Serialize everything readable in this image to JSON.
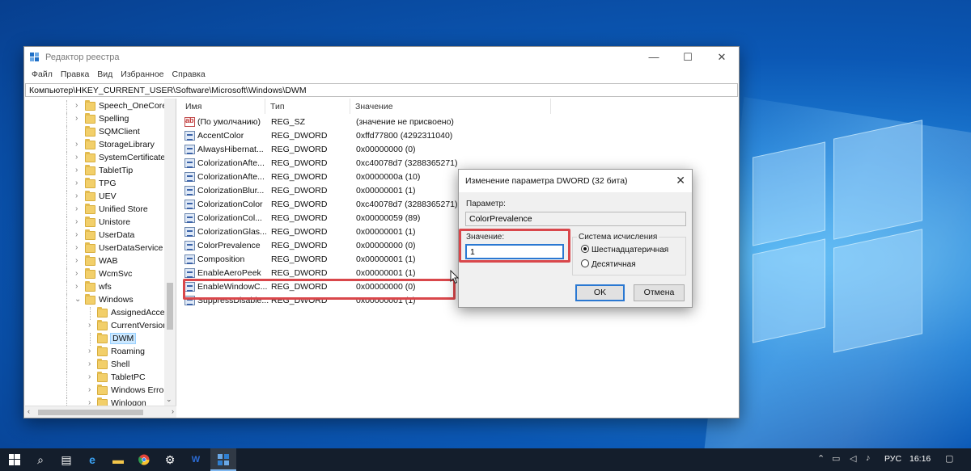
{
  "window": {
    "title": "Редактор реестра",
    "controls": {
      "minimize": "—",
      "maximize": "☐",
      "close": "✕"
    },
    "menu": [
      "Файл",
      "Правка",
      "Вид",
      "Избранное",
      "Справка"
    ],
    "address": "Компьютер\\HKEY_CURRENT_USER\\Software\\Microsoft\\Windows\\DWM"
  },
  "tree": {
    "items": [
      {
        "label": "Speech_OneCore",
        "expandable": true
      },
      {
        "label": "Spelling",
        "expandable": true
      },
      {
        "label": "SQMClient",
        "expandable": false
      },
      {
        "label": "StorageLibrary",
        "expandable": true
      },
      {
        "label": "SystemCertificate",
        "expandable": true
      },
      {
        "label": "TabletTip",
        "expandable": true
      },
      {
        "label": "TPG",
        "expandable": true
      },
      {
        "label": "UEV",
        "expandable": true
      },
      {
        "label": "Unified Store",
        "expandable": true
      },
      {
        "label": "Unistore",
        "expandable": true
      },
      {
        "label": "UserData",
        "expandable": true
      },
      {
        "label": "UserDataService",
        "expandable": true
      },
      {
        "label": "WAB",
        "expandable": true
      },
      {
        "label": "WcmSvc",
        "expandable": true
      },
      {
        "label": "wfs",
        "expandable": true
      },
      {
        "label": "Windows",
        "expandable": true,
        "expanded": true
      },
      {
        "label": "AssignedAcce",
        "expandable": false,
        "child": true
      },
      {
        "label": "CurrentVersion",
        "expandable": true,
        "child": true
      },
      {
        "label": "DWM",
        "expandable": false,
        "child": true,
        "selected": true
      },
      {
        "label": "Roaming",
        "expandable": true,
        "child": true
      },
      {
        "label": "Shell",
        "expandable": true,
        "child": true
      },
      {
        "label": "TabletPC",
        "expandable": true,
        "child": true
      },
      {
        "label": "Windows Error",
        "expandable": true,
        "child": true
      },
      {
        "label": "Winlogon",
        "expandable": true,
        "child": true
      }
    ]
  },
  "list": {
    "columns": [
      "Имя",
      "Тип",
      "Значение"
    ],
    "rows": [
      {
        "name": "(По умолчанию)",
        "type": "REG_SZ",
        "value": "(значение не присвоено)",
        "icon": "string-value-icon"
      },
      {
        "name": "AccentColor",
        "type": "REG_DWORD",
        "value": "0xffd77800 (4292311040)",
        "icon": "dword-value-icon"
      },
      {
        "name": "AlwaysHibernat...",
        "type": "REG_DWORD",
        "value": "0x00000000 (0)",
        "icon": "dword-value-icon"
      },
      {
        "name": "ColorizationAfte...",
        "type": "REG_DWORD",
        "value": "0xc40078d7 (3288365271)",
        "icon": "dword-value-icon"
      },
      {
        "name": "ColorizationAfte...",
        "type": "REG_DWORD",
        "value": "0x0000000a (10)",
        "icon": "dword-value-icon"
      },
      {
        "name": "ColorizationBlur...",
        "type": "REG_DWORD",
        "value": "0x00000001 (1)",
        "icon": "dword-value-icon"
      },
      {
        "name": "ColorizationColor",
        "type": "REG_DWORD",
        "value": "0xc40078d7 (3288365271)",
        "icon": "dword-value-icon"
      },
      {
        "name": "ColorizationCol...",
        "type": "REG_DWORD",
        "value": "0x00000059 (89)",
        "icon": "dword-value-icon"
      },
      {
        "name": "ColorizationGlas...",
        "type": "REG_DWORD",
        "value": "0x00000001 (1)",
        "icon": "dword-value-icon"
      },
      {
        "name": "ColorPrevalence",
        "type": "REG_DWORD",
        "value": "0x00000000 (0)",
        "icon": "dword-value-icon"
      },
      {
        "name": "Composition",
        "type": "REG_DWORD",
        "value": "0x00000001 (1)",
        "icon": "dword-value-icon"
      },
      {
        "name": "EnableAeroPeek",
        "type": "REG_DWORD",
        "value": "0x00000001 (1)",
        "icon": "dword-value-icon"
      },
      {
        "name": "EnableWindowC...",
        "type": "REG_DWORD",
        "value": "0x00000000 (0)",
        "icon": "dword-value-icon"
      },
      {
        "name": "SuppressDisable...",
        "type": "REG_DWORD",
        "value": "0x00000001 (1)",
        "icon": "dword-value-icon"
      }
    ]
  },
  "dialog": {
    "title": "Изменение параметра DWORD (32 бита)",
    "close": "✕",
    "param_label": "Параметр:",
    "param_value": "ColorPrevalence",
    "value_label": "Значение:",
    "value_input": "1",
    "base_label": "Система исчисления",
    "base_options": [
      "Шестнадцатеричная",
      "Десятичная"
    ],
    "base_selected": "Шестнадцатеричная",
    "ok": "OK",
    "cancel": "Отмена"
  },
  "taskbar": {
    "lang": "РУС",
    "time": "16:16"
  },
  "colors": {
    "highlight_red": "#d9474b",
    "selection_blue": "#cce8ff",
    "accent": "#2a78d2"
  }
}
